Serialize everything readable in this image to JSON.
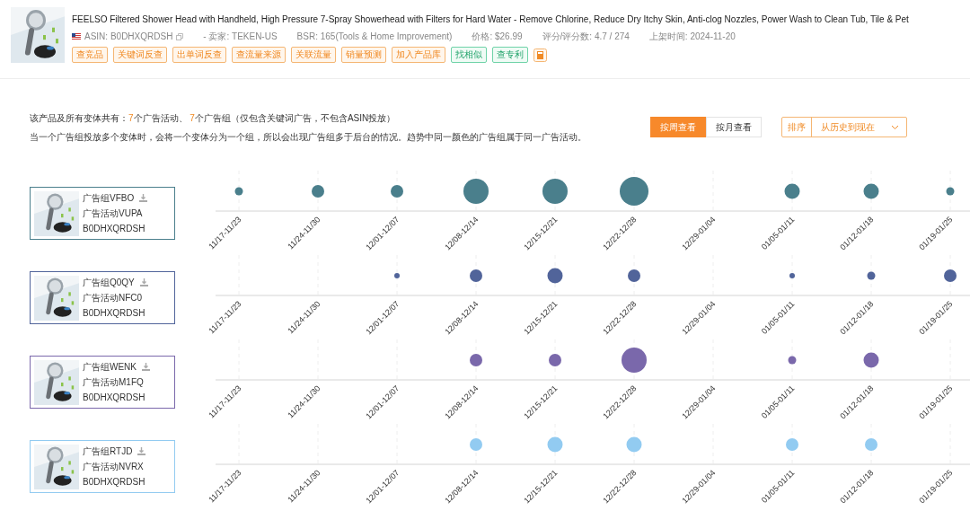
{
  "product": {
    "title": "FEELSO Filtered Shower Head with Handheld, High Pressure 7-Spray Showerhead with Filters for Hard Water - Remove Chlorine, Reduce Dry Itchy Skin, Anti-clog Nozzles, Power Wash to Clean Tub, Tile & Pet",
    "meta": [
      "ASIN: B0DHXQRDSH",
      "- 卖家: TEKEN-US",
      "BSR: 165(Tools & Home Improvement)",
      "价格: $26.99",
      "评分/评分数: 4.7 / 274",
      "上架时间: 2024-11-20"
    ],
    "tags": [
      {
        "label": "查竞品",
        "kind": "orange"
      },
      {
        "label": "关键词反查",
        "kind": "orange"
      },
      {
        "label": "出单词反查",
        "kind": "orange"
      },
      {
        "label": "查流量来源",
        "kind": "orange"
      },
      {
        "label": "关联流量",
        "kind": "orange"
      },
      {
        "label": "销量预测",
        "kind": "orange"
      },
      {
        "label": "加入产品库",
        "kind": "orange"
      },
      {
        "label": "找相似",
        "kind": "green"
      },
      {
        "label": "查专利",
        "kind": "green"
      }
    ]
  },
  "summary": {
    "prefix": "该产品及所有变体共有：",
    "campaigns": "7",
    "middle": "个广告活动、 ",
    "groups": "7",
    "suffix": "个广告组（仅包含关键词广告，不包含ASIN投放）"
  },
  "note": "当一个广告组投放多个变体时，会将一个变体分为一个组，所以会出现广告组多于后台的情况。趋势中同一颜色的广告组属于同一广告活动。",
  "view_tabs": [
    {
      "label": "按周查看",
      "selected": true
    },
    {
      "label": "按月查看",
      "selected": false
    }
  ],
  "sort": {
    "label": "排序",
    "value": "从历史到现在"
  },
  "ad_groups": [
    {
      "group": "广告组VFBO",
      "campaign": "广告活动VUPA",
      "asin": "B0DHXQRDSH",
      "color": "#4a7f8c",
      "weeks": [
        {
          "label": "11/17-11/23",
          "kind": "small"
        },
        {
          "label": "11/24-11/30",
          "kind": "medium"
        },
        {
          "label": "12/01-12/07",
          "kind": "medium"
        },
        {
          "label": "12/08-12/14",
          "kind": "huge"
        },
        {
          "label": "12/15-12/21",
          "kind": "huge"
        },
        {
          "label": "12/22-12/28",
          "kind": "giant"
        },
        {
          "label": "12/29-01/04",
          "kind": "empty"
        },
        {
          "label": "01/05-01/11",
          "kind": "large"
        },
        {
          "label": "01/12-01/18",
          "kind": "large"
        },
        {
          "label": "01/19-01/25",
          "kind": "small"
        }
      ]
    },
    {
      "group": "广告组Q0QY",
      "campaign": "广告活动NFC0",
      "asin": "B0DHXQRDSH",
      "color": "#51649a",
      "weeks": [
        {
          "label": "11/17-11/23",
          "kind": "empty"
        },
        {
          "label": "11/24-11/30",
          "kind": "empty"
        },
        {
          "label": "12/01-12/07",
          "kind": "tiny"
        },
        {
          "label": "12/08-12/14",
          "kind": "medium"
        },
        {
          "label": "12/15-12/21",
          "kind": "large"
        },
        {
          "label": "12/22-12/28",
          "kind": "medium"
        },
        {
          "label": "12/29-01/04",
          "kind": "empty"
        },
        {
          "label": "01/05-01/11",
          "kind": "tiny"
        },
        {
          "label": "01/12-01/18",
          "kind": "small"
        },
        {
          "label": "01/19-01/25",
          "kind": "medium"
        }
      ]
    },
    {
      "group": "广告组WENK",
      "campaign": "广告活动M1FQ",
      "asin": "B0DHXQRDSH",
      "color": "#7a68ab",
      "weeks": [
        {
          "label": "11/17-11/23",
          "kind": "empty"
        },
        {
          "label": "11/24-11/30",
          "kind": "empty"
        },
        {
          "label": "12/01-12/07",
          "kind": "empty"
        },
        {
          "label": "12/08-12/14",
          "kind": "medium"
        },
        {
          "label": "12/15-12/21",
          "kind": "medium"
        },
        {
          "label": "12/22-12/28",
          "kind": "huge"
        },
        {
          "label": "12/29-01/04",
          "kind": "empty"
        },
        {
          "label": "01/05-01/11",
          "kind": "small"
        },
        {
          "label": "01/12-01/18",
          "kind": "large"
        },
        {
          "label": "01/19-01/25",
          "kind": "empty"
        }
      ]
    },
    {
      "group": "广告组RTJD",
      "campaign": "广告活动NVRX",
      "asin": "B0DHXQRDSH",
      "color": "#92cbf1",
      "weeks": [
        {
          "label": "11/17-11/23",
          "kind": "empty"
        },
        {
          "label": "11/24-11/30",
          "kind": "empty"
        },
        {
          "label": "12/01-12/07",
          "kind": "empty"
        },
        {
          "label": "12/08-12/14",
          "kind": "medium"
        },
        {
          "label": "12/15-12/21",
          "kind": "large"
        },
        {
          "label": "12/22-12/28",
          "kind": "large"
        },
        {
          "label": "12/29-01/04",
          "kind": "empty"
        },
        {
          "label": "01/05-01/11",
          "kind": "medium"
        },
        {
          "label": "01/12-01/18",
          "kind": "medium"
        },
        {
          "label": "01/19-01/25",
          "kind": "empty"
        }
      ]
    }
  ]
}
